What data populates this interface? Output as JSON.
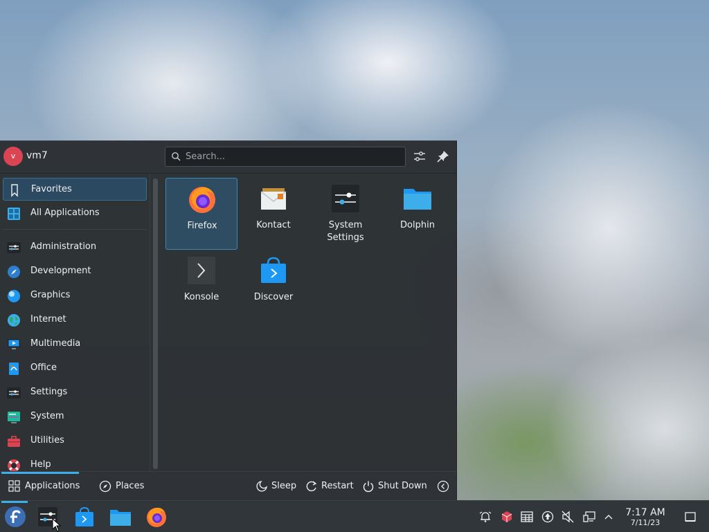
{
  "user": {
    "initial": "v",
    "name": "vm7"
  },
  "search": {
    "placeholder": "Search..."
  },
  "sidebar": {
    "items": [
      {
        "label": "Favorites",
        "icon": "bookmark-icon"
      },
      {
        "label": "All Applications",
        "icon": "grid-icon"
      },
      {
        "label": "Administration",
        "icon": "sliders-icon"
      },
      {
        "label": "Development",
        "icon": "compass-icon"
      },
      {
        "label": "Graphics",
        "icon": "sphere-icon"
      },
      {
        "label": "Internet",
        "icon": "globe-icon"
      },
      {
        "label": "Multimedia",
        "icon": "monitor-icon"
      },
      {
        "label": "Office",
        "icon": "document-icon"
      },
      {
        "label": "Settings",
        "icon": "sliders-icon"
      },
      {
        "label": "System",
        "icon": "system-icon"
      },
      {
        "label": "Utilities",
        "icon": "toolbox-icon"
      },
      {
        "label": "Help",
        "icon": "lifebuoy-icon"
      }
    ]
  },
  "favorites": [
    {
      "label": "Firefox",
      "icon": "firefox-icon"
    },
    {
      "label": "Kontact",
      "icon": "kontact-icon"
    },
    {
      "label": "System Settings",
      "icon": "system-settings-icon"
    },
    {
      "label": "Dolphin",
      "icon": "folder-icon"
    },
    {
      "label": "Konsole",
      "icon": "terminal-icon"
    },
    {
      "label": "Discover",
      "icon": "store-bag-icon"
    }
  ],
  "footer": {
    "applications": "Applications",
    "places": "Places",
    "sleep": "Sleep",
    "restart": "Restart",
    "shutdown": "Shut Down"
  },
  "clock": {
    "time": "7:17 AM",
    "date": "7/11/23"
  },
  "colors": {
    "accent": "#3daee9",
    "panel": "#2a2e32",
    "taskbar": "#31363b",
    "avatar": "#da4453"
  }
}
